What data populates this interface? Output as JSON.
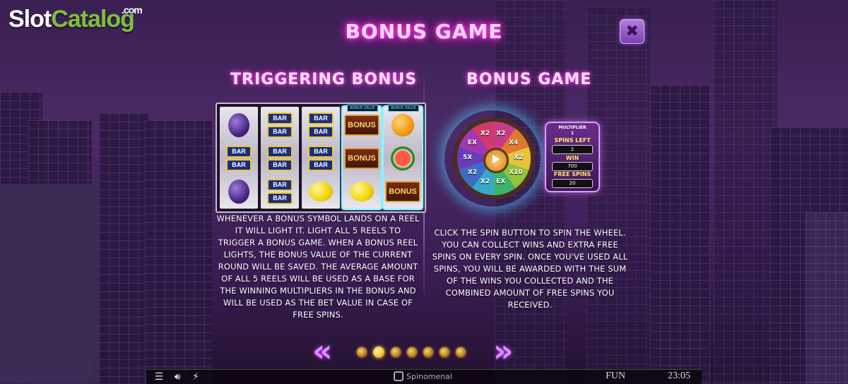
{
  "watermark": {
    "part1": "Slot",
    "part2": "Catalog",
    "suffix": ".com"
  },
  "title": "BONUS GAME",
  "close_icon": "close-icon",
  "left": {
    "heading": "TRIGGERING BONUS",
    "reel_tag": "BONUS VALUE",
    "reels": [
      [
        "plum",
        "bar",
        "plum"
      ],
      [
        "bar",
        "bar",
        "bar"
      ],
      [
        "bar",
        "bar",
        "lemon"
      ],
      [
        "bonus",
        "bonus",
        "lemon"
      ],
      [
        "orange",
        "melon",
        "bonus"
      ]
    ],
    "bar_text": "BAR",
    "bonus_text": "BONUS",
    "description": "Whenever a Bonus symbol lands on a reel it will light it. Light all 5 reels to trigger a Bonus Game. When a Bonus reel lights, the bonus value of the current round will be saved. The average amount of all 5 reels will be used as a base for the winning multipliers in the bonus and will be used as the bet value in case of free spins."
  },
  "right": {
    "heading": "BONUS GAME",
    "wheel_labels": [
      "X2",
      "X4",
      "X2",
      "X10",
      "EX",
      "X2",
      "X2",
      "5X",
      "EX",
      "X2"
    ],
    "panel": {
      "multiplier_label": "MULTIPLIER",
      "multiplier_value": "1",
      "spins_left_label": "SPINS LEFT",
      "spins_left_value": "1",
      "win_label": "WIN",
      "win_value": "700",
      "free_spins_label": "FREE SPINS",
      "free_spins_value": "20"
    },
    "description": "Click the Spin button to spin the wheel. You can collect wins and extra free spins on every spin. Once you've used all spins, you will be awarded with the sum of the wins you collected and the combined amount of free spins you received."
  },
  "navigation": {
    "prev": "«",
    "next": "»",
    "page_count": 7,
    "active_page": 2
  },
  "bottom_bar": {
    "brand": "Spinomenal",
    "mode": "FUN",
    "time": "23:05"
  },
  "colors": {
    "neon_pink": "#ff2bd9",
    "arrow_purple": "#e08aff",
    "logo_green": "#7ec03a"
  }
}
